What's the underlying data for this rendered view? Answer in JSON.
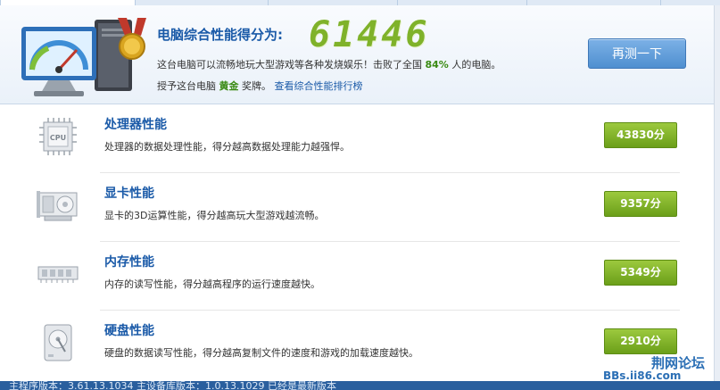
{
  "summary": {
    "title": "电脑综合性能得分为:",
    "score": "61446",
    "line1_prefix": "这台电脑可以流畅地玩大型游戏等各种发烧娱乐！击败了全国 ",
    "beat_percent": "84%",
    "line1_suffix": " 人的电脑。",
    "line2_prefix": "授予这台电脑 ",
    "award": "黄金",
    "line2_mid": " 奖牌。",
    "ranking_link": "查看综合性能排行榜",
    "retest_label": "再测一下"
  },
  "items": [
    {
      "name": "处理器性能",
      "desc": "处理器的数据处理性能，得分越高数据处理能力越强悍。",
      "score": "43830分",
      "icon": "cpu-icon"
    },
    {
      "name": "显卡性能",
      "desc": "显卡的3D运算性能，得分越高玩大型游戏越流畅。",
      "score": "9357分",
      "icon": "graphics-card-icon"
    },
    {
      "name": "内存性能",
      "desc": "内存的读写性能，得分越高程序的运行速度越快。",
      "score": "5349分",
      "icon": "memory-icon"
    },
    {
      "name": "硬盘性能",
      "desc": "硬盘的数据读写性能，得分越高复制文件的速度和游戏的加载速度越快。",
      "score": "2910分",
      "icon": "hard-disk-icon"
    }
  ],
  "status_bar": {
    "text": "主程序版本：3.61.13.1034   主设备库版本：1.0.13.1029   已经是最新版本"
  },
  "watermark": {
    "brand": "荆网论坛",
    "url": "BBs.ii86.com"
  },
  "colors": {
    "accent_blue": "#1a5aa8",
    "score_green": "#7fb22a",
    "badge_green": "#6b9f19",
    "status_bar": "#2a5f9e"
  }
}
